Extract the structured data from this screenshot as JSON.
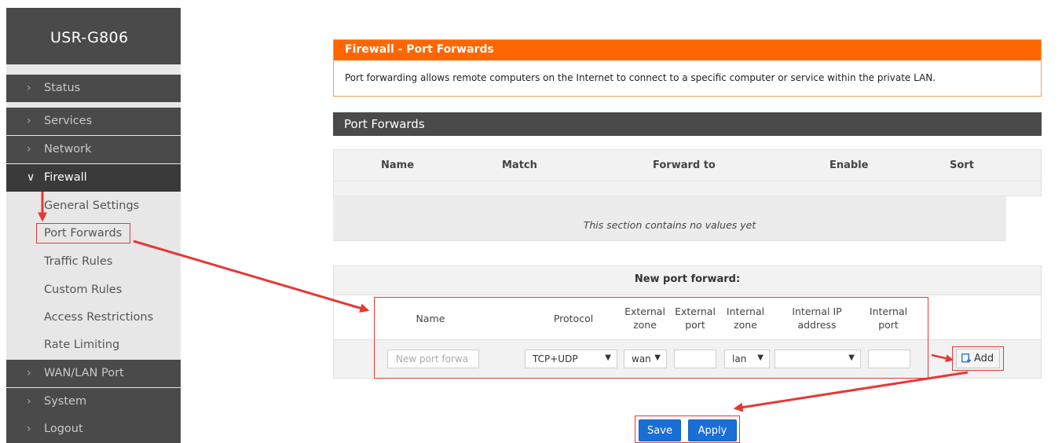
{
  "brand": "USR-G806",
  "sidebar": {
    "items": [
      {
        "label": "Status",
        "type": "top"
      },
      {
        "label": "Services",
        "type": "top"
      },
      {
        "label": "Network",
        "type": "top"
      },
      {
        "label": "Firewall",
        "type": "active"
      },
      {
        "label": "General Settings",
        "type": "sub"
      },
      {
        "label": "Port Forwards",
        "type": "sub",
        "selected": true
      },
      {
        "label": "Traffic Rules",
        "type": "sub"
      },
      {
        "label": "Custom Rules",
        "type": "sub"
      },
      {
        "label": "Access Restrictions",
        "type": "sub"
      },
      {
        "label": "Rate Limiting",
        "type": "sub"
      },
      {
        "label": "WAN/LAN Port",
        "type": "top"
      },
      {
        "label": "System",
        "type": "top"
      },
      {
        "label": "Logout",
        "type": "top"
      }
    ]
  },
  "firewall_panel": {
    "title": "Firewall - Port Forwards",
    "description": "Port forwarding allows remote computers on the Internet to connect to a specific computer or service within the private LAN."
  },
  "port_forwards": {
    "section_title": "Port Forwards",
    "columns": [
      "Name",
      "Match",
      "Forward to",
      "Enable",
      "Sort"
    ],
    "empty_text": "This section contains no values yet"
  },
  "new_port_forward": {
    "title": "New port forward:",
    "columns": {
      "name": "Name",
      "protocol": "Protocol",
      "ext_zone": [
        "External",
        "zone"
      ],
      "ext_port": [
        "External",
        "port"
      ],
      "int_zone": [
        "Internal",
        "zone"
      ],
      "int_ip": [
        "Internal IP",
        "address"
      ],
      "int_port": [
        "Internal",
        "port"
      ]
    },
    "name_placeholder": "New port forwa",
    "protocol_value": "TCP+UDP",
    "ext_zone_value": "wan",
    "ext_port_value": "",
    "int_zone_value": "lan",
    "int_ip_value": "",
    "int_port_value": "",
    "add_label": "Add"
  },
  "actions": {
    "save_label": "Save",
    "apply_label": "Apply"
  },
  "colors": {
    "accent_orange": "#ff6600",
    "header_dark": "#4a4a4a",
    "button_blue": "#1a6fd6",
    "annotation_red": "#e53935"
  }
}
